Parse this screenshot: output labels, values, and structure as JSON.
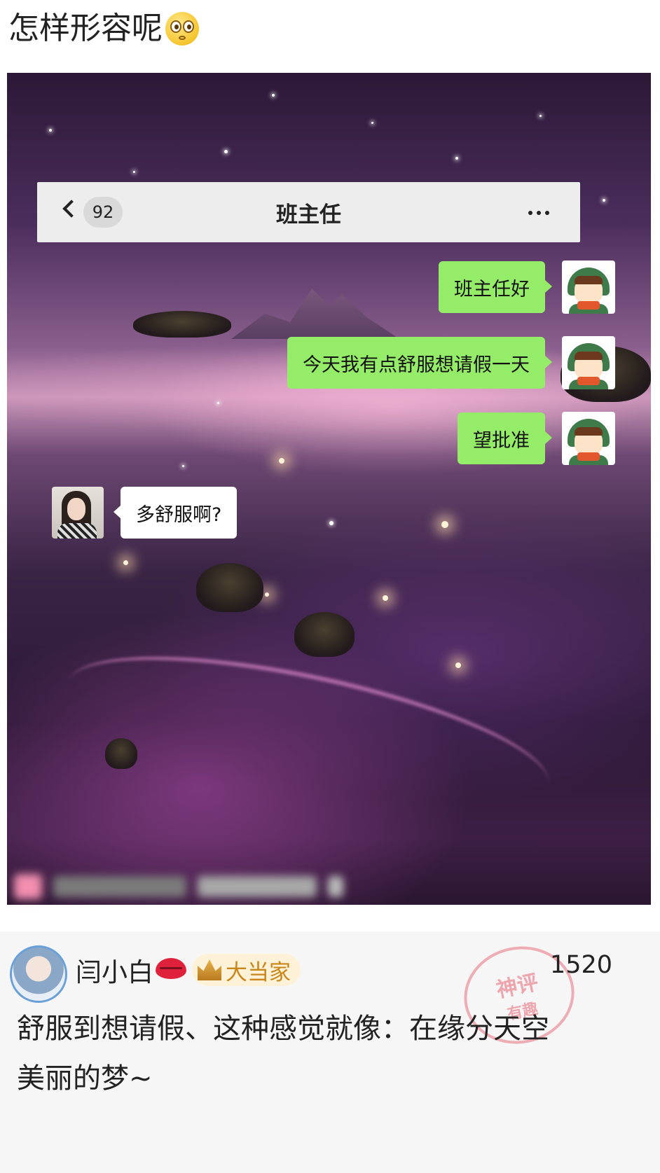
{
  "post": {
    "title": "怎样形容呢",
    "title_emoji_icon": "flushed-face-icon"
  },
  "chat": {
    "unread_count": "92",
    "contact_name": "班主任",
    "messages": [
      {
        "side": "right",
        "text": "班主任好"
      },
      {
        "side": "right",
        "text": "今天我有点舒服想请假一天"
      },
      {
        "side": "right",
        "text": "望批准"
      },
      {
        "side": "left",
        "text": "多舒服啊?"
      }
    ]
  },
  "comment": {
    "username": "闫小白",
    "rank_label": "大当家",
    "like_count": "1520",
    "text": "舒服到想请假、这种感觉就像：在缘分天空\n美丽的梦~",
    "stamp_line1": "神评",
    "stamp_line2": "有趣"
  },
  "colors": {
    "sent_bubble": "#95ec69",
    "received_bubble": "#ffffff",
    "rank_text": "#c9861a",
    "stamp": "#e8707e"
  }
}
